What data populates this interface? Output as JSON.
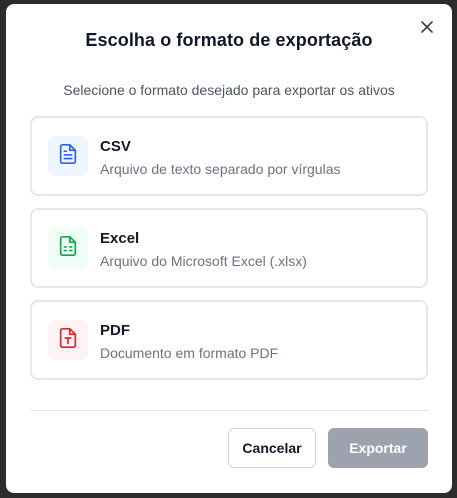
{
  "dialog": {
    "title": "Escolha o formato de exportação",
    "subtitle": "Selecione o formato desejado para exportar os ativos",
    "close_icon": "close-icon"
  },
  "options": [
    {
      "id": "csv",
      "label": "CSV",
      "description": "Arquivo de texto separado por vírgulas",
      "icon": "file-text-icon",
      "icon_color": "#2563eb",
      "icon_bg": "#eff6ff"
    },
    {
      "id": "excel",
      "label": "Excel",
      "description": "Arquivo do Microsoft Excel (.xlsx)",
      "icon": "file-spreadsheet-icon",
      "icon_color": "#16a34a",
      "icon_bg": "#f0fdf4"
    },
    {
      "id": "pdf",
      "label": "PDF",
      "description": "Documento em formato PDF",
      "icon": "file-pdf-icon",
      "icon_color": "#dc2626",
      "icon_bg": "#fef2f2"
    }
  ],
  "actions": {
    "cancel_label": "Cancelar",
    "export_label": "Exportar",
    "export_disabled": true
  }
}
